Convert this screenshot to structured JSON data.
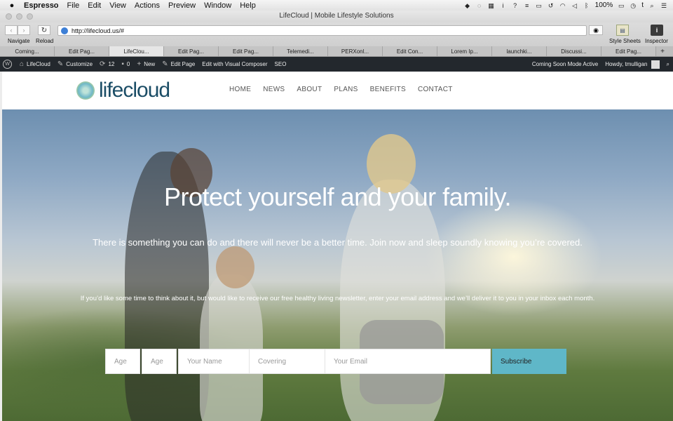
{
  "menubar": {
    "apple": "",
    "app": "Espresso",
    "items": [
      "File",
      "Edit",
      "View",
      "Actions",
      "Preview",
      "Window",
      "Help"
    ],
    "battery": "100%",
    "user": "t"
  },
  "window": {
    "title": "LifeCloud | Mobile Lifestyle Solutions"
  },
  "toolbar": {
    "navigate_label": "Navigate",
    "reload_label": "Reload",
    "url": "http://lifecloud.us/#",
    "stylesheets_label": "Style Sheets",
    "inspector_label": "Inspector"
  },
  "tabs": [
    "Coming...",
    "Edit Pag...",
    "LifeClou...",
    "Edit Pag...",
    "Edit Pag...",
    "Telemedi...",
    "PERXonl...",
    "Edit Con...",
    "Lorem Ip...",
    "launchki...",
    "Discussi...",
    "Edit Pag..."
  ],
  "tabs_plus": "+",
  "wpbar": {
    "site": "LifeCloud",
    "customize": "Customize",
    "updates": "12",
    "comments": "0",
    "new": "New",
    "edit_page": "Edit Page",
    "visual_composer": "Edit with Visual Composer",
    "seo": "SEO",
    "coming_soon": "Coming Soon Mode Active",
    "howdy": "Howdy, tmulligan"
  },
  "site": {
    "logo_text": "lifecloud",
    "nav": [
      "HOME",
      "NEWS",
      "ABOUT",
      "PLANS",
      "BENEFITS",
      "CONTACT"
    ],
    "headline": "Protect yourself and your family.",
    "subheadline": "There is something you can do and there will never be a better time. Join now and sleep soundly knowing you’re covered.",
    "newsletter_text": "If you’d like some time to think about it, but would like to receive our free healthy living newsletter, enter your email address and we’ll deliver it to you in your inbox each month.",
    "form": {
      "age1_placeholder": "Age",
      "age2_placeholder": "Age",
      "name_placeholder": "Your Name",
      "covering_placeholder": "Covering",
      "email_placeholder": "Your Email",
      "subscribe_label": "Subscribe"
    }
  },
  "colors": {
    "accent": "#5fb7c8",
    "logo": "#1b4d66",
    "wpbar": "#23282d"
  }
}
